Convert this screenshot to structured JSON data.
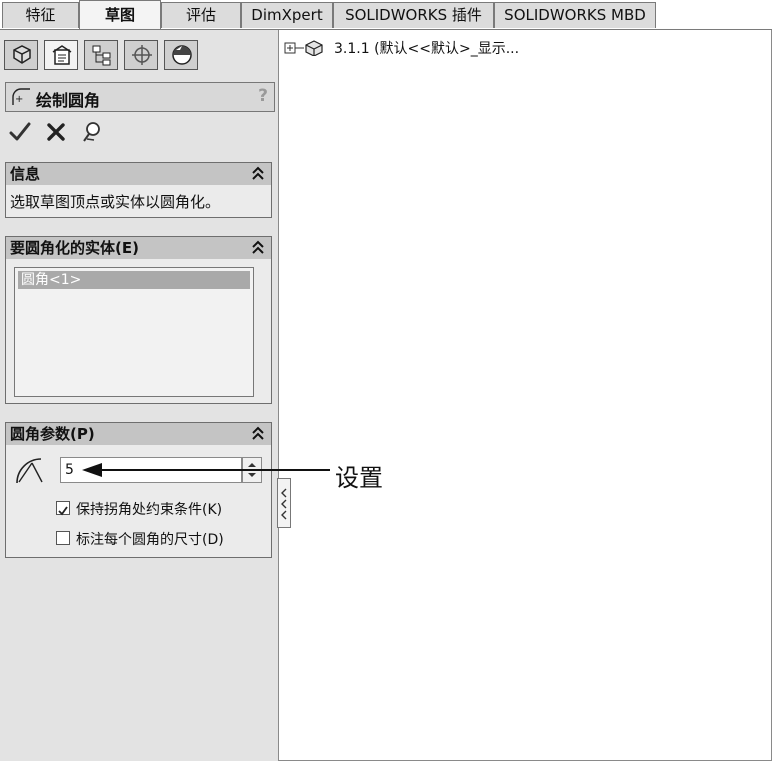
{
  "tabs": [
    "特征",
    "草图",
    "评估",
    "DimXpert",
    "SOLIDWORKS 插件",
    "SOLIDWORKS MBD"
  ],
  "active_tab": "草图",
  "panel_icons": [
    "feature-manager-icon",
    "property-manager-icon",
    "configuration-manager-icon",
    "dimxpert-manager-icon",
    "display-manager-icon"
  ],
  "property_manager": {
    "title": "绘制圆角",
    "help": "?",
    "actions": [
      "ok-check-icon",
      "cancel-x-icon",
      "pushpin-icon"
    ]
  },
  "info_box": {
    "header": "信息",
    "text": "选取草图顶点或实体以圆角化。"
  },
  "entities_box": {
    "header": "要圆角化的实体(E)",
    "items": [
      "圆角<1>"
    ]
  },
  "params_box": {
    "header": "圆角参数(P)",
    "radius_value": "5",
    "keep_constraints_label": "保持拐角处约束条件(K)",
    "keep_constraints_checked": true,
    "dimension_each_label": "标注每个圆角的尺寸(D)",
    "dimension_each_checked": false
  },
  "tree": {
    "expander": "⊞",
    "label": "3.1.1  (默认<<默认>_显示..."
  },
  "annotation": {
    "text": "设置"
  }
}
